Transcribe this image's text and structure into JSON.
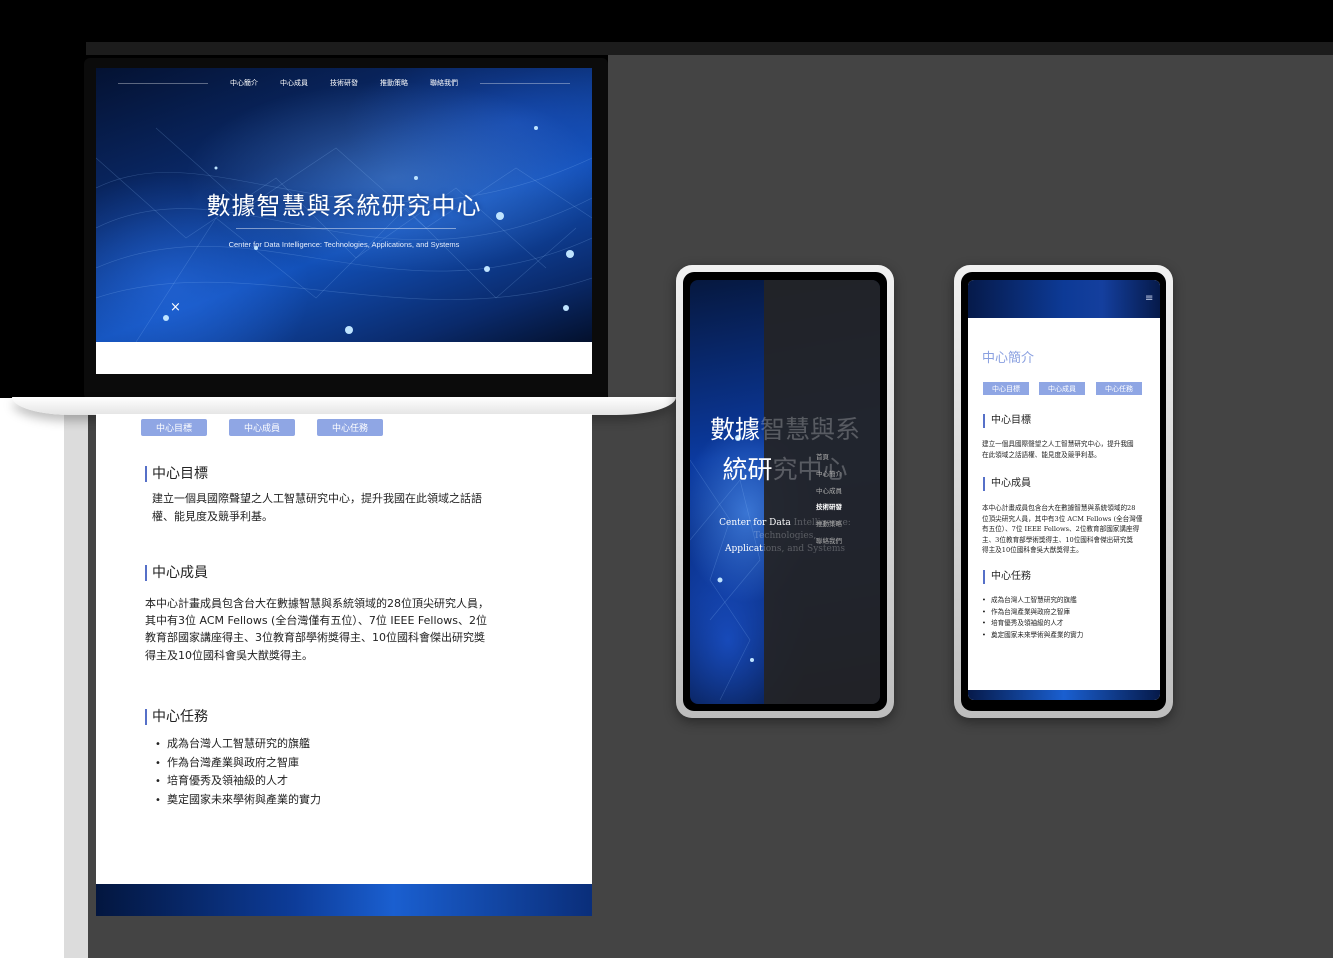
{
  "laptop": {
    "nav": [
      "中心簡介",
      "中心成員",
      "技術研發",
      "推動策略",
      "聯絡我們"
    ],
    "hero_title": "數據智慧與系統研究中心",
    "hero_subtitle": "Center for Data Intelligence: Technologies, Applications, and Systems"
  },
  "page": {
    "tags": [
      "中心目標",
      "中心成員",
      "中心任務"
    ],
    "goal_heading": "中心目標",
    "goal_text_1": "建立一個具國際聲望之人工智慧研究中心，提升我國在此領域之話語",
    "goal_text_2": "權、能見度及競爭利基。",
    "members_heading": "中心成員",
    "members_text": [
      "本中心計畫成員包含台大在數據智慧與系統領域的28位頂尖研究人員，",
      "其中有3位 ACM Fellows (全台灣僅有五位）、7位 IEEE Fellows、2位",
      "教育部國家講座得主、3位教育部學術獎得主、10位國科會傑出研究獎",
      "得主及10位國科會吳大猷獎得主。"
    ],
    "mission_heading": "中心任務",
    "mission_items": [
      "成為台灣人工智慧研究的旗艦",
      "作為台灣產業與政府之智庫",
      "培育優秀及領袖級的人才",
      "奠定國家未來學術與產業的實力"
    ]
  },
  "tablet": {
    "close": "×",
    "title_line1_a": "數據",
    "title_line1_b": "智慧與系",
    "title_line2_a": "統研",
    "title_line2_b": "究中心",
    "sub_line1_a": "Center for Data ",
    "sub_line1_b": "Intelligence: Technologies,",
    "sub_line2_a": "Applicat",
    "sub_line2_b": "ions, and Systems",
    "menu": [
      "首頁",
      "中心簡介",
      "中心成員",
      "技術研發",
      "推動策略",
      "聯絡我們"
    ],
    "menu_active": "技術研發"
  },
  "phone": {
    "burger": "≡",
    "title": "中心簡介",
    "tags": [
      "中心目標",
      "中心成員",
      "中心任務"
    ],
    "goal_heading": "中心目標",
    "goal_text": [
      "建立一個具國際聲望之人工智慧研究中心，提升我國",
      "在此領域之話語權、能見度及競爭利基。"
    ],
    "members_heading": "中心成員",
    "members_text": [
      "本中心計畫成員包含台大在數據智慧與系統領域的28",
      "位頂尖研究人員，其中有3位 ACM Fellows (全台灣僅",
      "有五位）、7位 IEEE Fellows、2位教育部國家講座得",
      "主、3位教育部學術獎得主、10位國科會傑出研究獎",
      "得主及10位國科會吳大猷獎得主。"
    ],
    "mission_heading": "中心任務",
    "mission_items": [
      "成為台灣人工智慧研究的旗艦",
      "作為台灣產業與政府之智庫",
      "培育優秀及領袖級的人才",
      "奠定國家未來學術與產業的實力"
    ]
  },
  "colors": {
    "accent_blue": "#8fa6e4",
    "heading_bar": "#5670c8",
    "hero_blue": "#0b3aa0"
  }
}
